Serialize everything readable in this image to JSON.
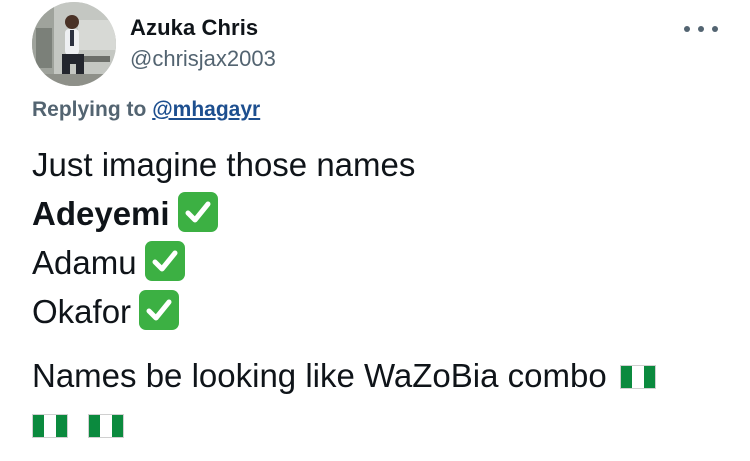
{
  "tweet": {
    "author": {
      "display_name": "Azuka Chris",
      "handle": "@chrisjax2003"
    },
    "reply_to": {
      "prefix": "Replying to",
      "mention": "@mhagayr"
    },
    "lines": [
      "Just imagine those names",
      "Adeyemi",
      "Adamu",
      "Okafor",
      "Names be looking like WaZoBia combo"
    ],
    "icons": {
      "check": "white-heavy-check-mark-icon",
      "flag": "nigeria-flag-icon"
    },
    "colors": {
      "text": "#0f1419",
      "muted": "#536471",
      "mention": "#1d4f8f",
      "check": "#3cb043",
      "flag_green": "#0b8a3e"
    }
  }
}
